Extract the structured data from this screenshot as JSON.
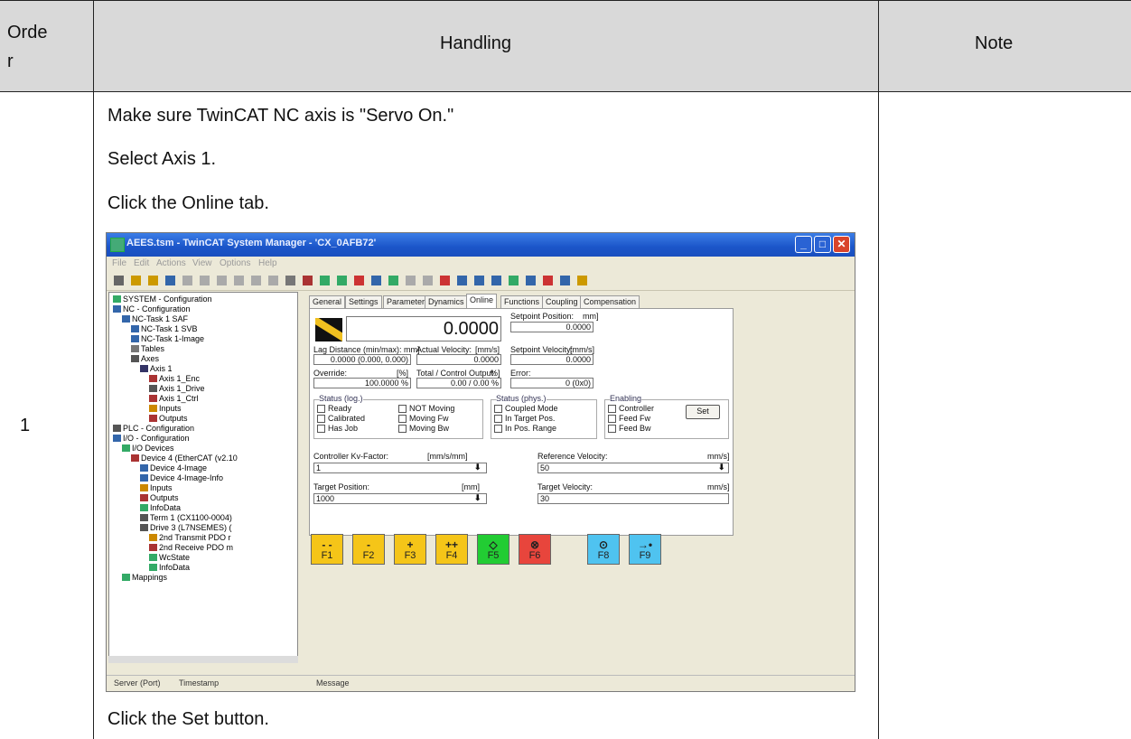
{
  "table": {
    "headers": {
      "order": "Orde\nr",
      "handling": "Handling",
      "note": "Note"
    },
    "row_number": "1",
    "steps": [
      "Make sure TwinCAT NC axis is \"Servo On.\"",
      "Select Axis 1.",
      "Click the Online tab.",
      "Click the Set button."
    ]
  },
  "screenshot": {
    "window_title": "AEES.tsm - TwinCAT System Manager - 'CX_0AFB72'",
    "menu": [
      "File",
      "Edit",
      "Actions",
      "View",
      "Options",
      "Help"
    ],
    "tree": [
      {
        "label": "SYSTEM - Configuration",
        "indent": 0,
        "color": "#3a6"
      },
      {
        "label": "NC - Configuration",
        "indent": 0,
        "color": "#36a"
      },
      {
        "label": "NC-Task 1 SAF",
        "indent": 1,
        "color": "#36a"
      },
      {
        "label": "NC-Task 1 SVB",
        "indent": 2,
        "color": "#36a"
      },
      {
        "label": "NC-Task 1-Image",
        "indent": 2,
        "color": "#36a"
      },
      {
        "label": "Tables",
        "indent": 2,
        "color": "#777"
      },
      {
        "label": "Axes",
        "indent": 2,
        "color": "#555"
      },
      {
        "label": "Axis 1",
        "indent": 3,
        "color": "#336"
      },
      {
        "label": "Axis 1_Enc",
        "indent": 4,
        "color": "#a33"
      },
      {
        "label": "Axis 1_Drive",
        "indent": 4,
        "color": "#555"
      },
      {
        "label": "Axis 1_Ctrl",
        "indent": 4,
        "color": "#a33"
      },
      {
        "label": "Inputs",
        "indent": 4,
        "color": "#c80"
      },
      {
        "label": "Outputs",
        "indent": 4,
        "color": "#a33"
      },
      {
        "label": "PLC - Configuration",
        "indent": 0,
        "color": "#555"
      },
      {
        "label": "I/O - Configuration",
        "indent": 0,
        "color": "#36a"
      },
      {
        "label": "I/O Devices",
        "indent": 1,
        "color": "#3a6"
      },
      {
        "label": "Device 4 (EtherCAT (v2.10",
        "indent": 2,
        "color": "#a33"
      },
      {
        "label": "Device 4-Image",
        "indent": 3,
        "color": "#36a"
      },
      {
        "label": "Device 4-Image-Info",
        "indent": 3,
        "color": "#36a"
      },
      {
        "label": "Inputs",
        "indent": 3,
        "color": "#c80"
      },
      {
        "label": "Outputs",
        "indent": 3,
        "color": "#a33"
      },
      {
        "label": "InfoData",
        "indent": 3,
        "color": "#3a6"
      },
      {
        "label": "Term 1 (CX1100-0004)",
        "indent": 3,
        "color": "#555"
      },
      {
        "label": "Drive 3 (L7NSEMES) (",
        "indent": 3,
        "color": "#555"
      },
      {
        "label": "2nd Transmit PDO r",
        "indent": 4,
        "color": "#c80"
      },
      {
        "label": "2nd Receive PDO m",
        "indent": 4,
        "color": "#a33"
      },
      {
        "label": "WcState",
        "indent": 4,
        "color": "#3a6"
      },
      {
        "label": "InfoData",
        "indent": 4,
        "color": "#3a6"
      },
      {
        "label": "Mappings",
        "indent": 1,
        "color": "#3a6"
      }
    ],
    "tabs": [
      "General",
      "Settings",
      "Parameter",
      "Dynamics",
      "Online",
      "Functions",
      "Coupling",
      "Compensation"
    ],
    "online": {
      "position_value": "0.0000",
      "setpoint_position_label": "Setpoint Position:",
      "setpoint_position_unit": "mm]",
      "setpoint_position_value": "0.0000",
      "lag_label": "Lag Distance (min/max):  mm]",
      "lag_value": "0.0000  (0.000, 0.000)",
      "actual_velocity_label": "Actual Velocity:",
      "actual_velocity_unit": "[mm/s]",
      "actual_velocity_value": "0.0000",
      "setpoint_velocity_label": "Setpoint Velocity:",
      "setpoint_velocity_unit": "[mm/s]",
      "setpoint_velocity_value": "0.0000",
      "override_label": "Override:",
      "override_unit": "[%]",
      "override_value": "100.0000 %",
      "total_output_label": "Total / Control Output:",
      "total_output_unit": "%]",
      "total_output_value": "0.00 / 0.00 %",
      "error_label": "Error:",
      "error_value": "0 (0x0)",
      "status_log_title": "Status (log.)",
      "status_log_items": [
        "Ready",
        "NOT Moving",
        "Calibrated",
        "Moving Fw",
        "Has Job",
        "Moving Bw"
      ],
      "status_phys_title": "Status (phys.)",
      "status_phys_items": [
        "Coupled Mode",
        "In Target Pos.",
        "In Pos. Range"
      ],
      "enabling_title": "Enabling",
      "enabling_items": [
        "Controller",
        "Feed Fw",
        "Feed Bw"
      ],
      "set_button": "Set",
      "kv_label": "Controller Kv-Factor:",
      "kv_unit": "[mm/s/mm]",
      "kv_value": "1",
      "ref_velocity_label": "Reference Velocity:",
      "ref_velocity_unit": "mm/s]",
      "ref_velocity_value": "50",
      "target_position_label": "Target Position:",
      "target_position_unit": "[mm]",
      "target_position_value": "1000",
      "target_velocity_label": "Target Velocity:",
      "target_velocity_unit": "mm/s]",
      "target_velocity_value": "30"
    },
    "function_keys": [
      {
        "key": "F1",
        "symbol": "- -",
        "color": "#f5c518"
      },
      {
        "key": "F2",
        "symbol": "-",
        "color": "#f5c518"
      },
      {
        "key": "F3",
        "symbol": "+",
        "color": "#f5c518"
      },
      {
        "key": "F4",
        "symbol": "++",
        "color": "#f5c518"
      },
      {
        "key": "F5",
        "symbol": "◇",
        "color": "#22cc33"
      },
      {
        "key": "F6",
        "symbol": "⊗",
        "color": "#e8453c"
      },
      {
        "key": "F8",
        "symbol": "⊙",
        "color": "#4fc3f0"
      },
      {
        "key": "F9",
        "symbol": "→•",
        "color": "#4fc3f0"
      }
    ],
    "status_bar": [
      "Server (Port)",
      "Timestamp",
      "Message"
    ]
  },
  "colors": {
    "header_bg": "#d9d9d9",
    "title_bar": "#1b55c9"
  }
}
